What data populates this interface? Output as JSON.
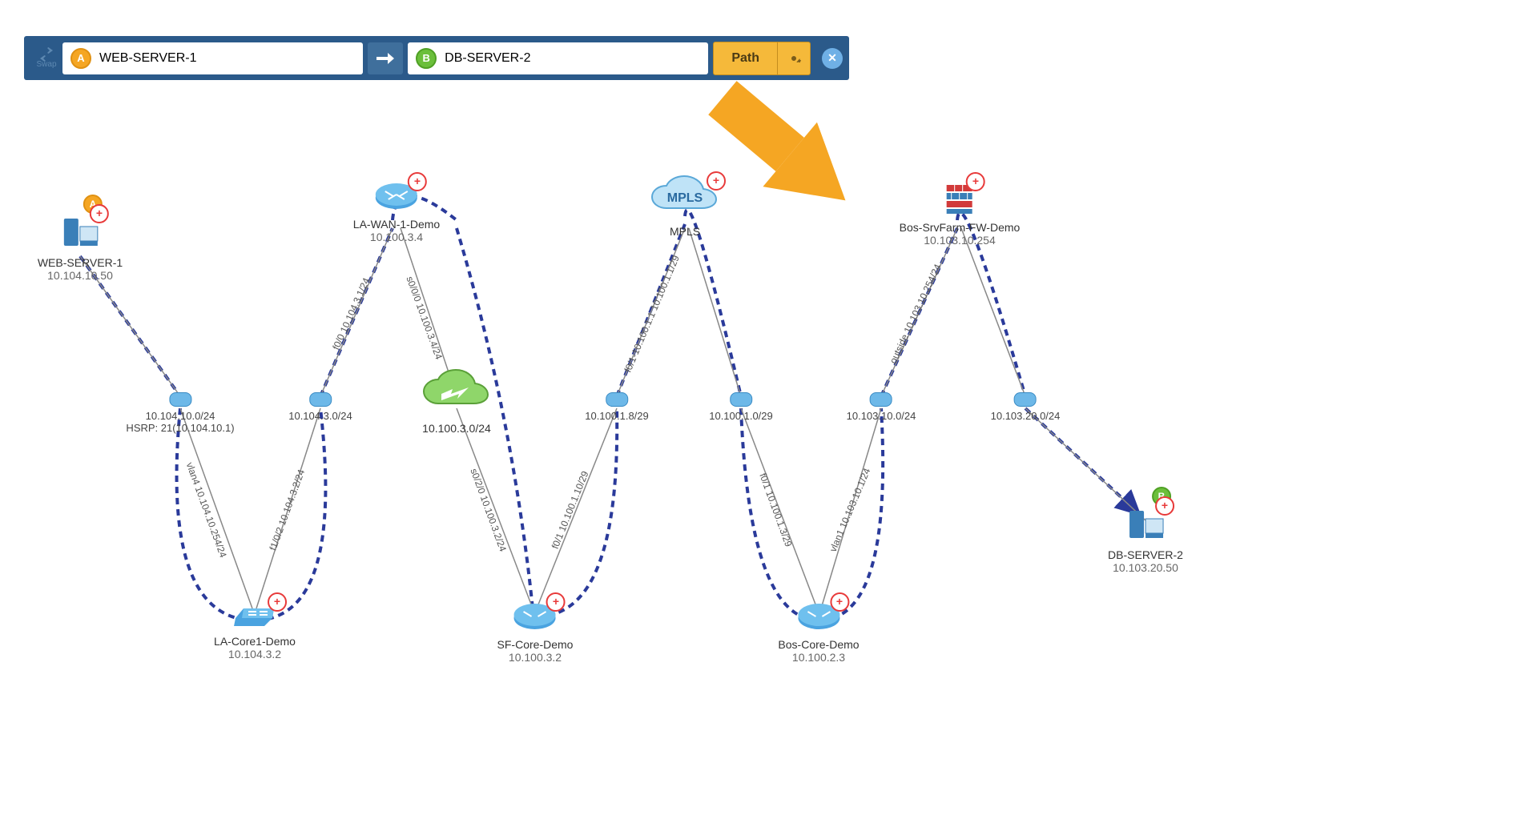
{
  "toolbar": {
    "swap_label": "Swap",
    "source": {
      "badge": "A",
      "value": "WEB-SERVER-1"
    },
    "dest": {
      "badge": "B",
      "value": "DB-SERVER-2"
    },
    "path_label": "Path"
  },
  "nodes": {
    "web": {
      "name": "WEB-SERVER-1",
      "ip": "10.104.10.50"
    },
    "lawan": {
      "name": "LA-WAN-1-Demo",
      "ip": "10.100.3.4"
    },
    "mpls": {
      "name": "MPLS"
    },
    "bossrv": {
      "name": "Bos-SrvFarm-FW-Demo",
      "ip": "10.103.10.254"
    },
    "lacore": {
      "name": "LA-Core1-Demo",
      "ip": "10.104.3.2"
    },
    "sfcore": {
      "name": "SF-Core-Demo",
      "ip": "10.100.3.2"
    },
    "boscore": {
      "name": "Bos-Core-Demo",
      "ip": "10.100.2.3"
    },
    "db": {
      "name": "DB-SERVER-2",
      "ip": "10.103.20.50"
    }
  },
  "subnets": {
    "s1": {
      "label": "10.104.10.0/24",
      "sub": "HSRP: 21(10.104.10.1)"
    },
    "s2": {
      "label": "10.104.3.0/24"
    },
    "s3": {
      "label": "10.100.3.0/24"
    },
    "s4": {
      "label": "10.100.1.8/29"
    },
    "s5": {
      "label": "10.100.1.0/29"
    },
    "s6": {
      "label": "10.103.10.0/24"
    },
    "s7": {
      "label": "10.103.20.0/24"
    }
  },
  "links": {
    "l1": "vlan4 10.104.10.254/24",
    "l2": "f1/0/2 10.104.3.2/24",
    "l3": "f0/0 10.104.3.1/24",
    "l4": "s0/0/0 10.100.3.4/24",
    "l5": "s0/2/0 10.100.3.2/24",
    "l6": "f0/1 10.100.1.10/29",
    "l7": "f0/1-10.100.1.1 10.100.1.1/29",
    "l8": "f0/1 10.100.1.3/29",
    "l9": "vlan1 10.103.10.1/24",
    "l10": "outside 10.103.10.254/24"
  }
}
